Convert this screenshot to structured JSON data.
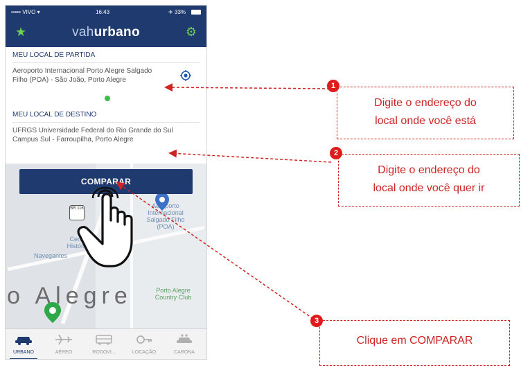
{
  "status_bar": {
    "carrier": "••••• VIVO ▾",
    "time": "16:43",
    "battery": "✈ 33%"
  },
  "app": {
    "logo_light": "vah",
    "logo_bold": "urbano",
    "star_icon": "star-icon",
    "settings_icon": "gear-icon"
  },
  "origin": {
    "label": "MEU LOCAL DE PARTIDA",
    "value": "Aeroporto Internacional Porto Alegre Salgado Filho (POA) - São João, Porto Alegre"
  },
  "destination": {
    "label": "MEU LOCAL DE DESTINO",
    "value": "UFRGS Universidade Federal do Rio Grande do Sul Campus Sul - Farroupilha, Porto Alegre"
  },
  "compare_button": "COMPARAR",
  "map": {
    "highway": "BR 116",
    "airport_label": "Aeroporto Internacional Salgado Filho (POA)",
    "centro_label": "Centro Histórico",
    "navegantes_label": "Navegantes",
    "city_label": "o Alegre",
    "country_club_label": "Porto Alegre Country Club"
  },
  "tabs": [
    {
      "label": "URBANO",
      "active": true
    },
    {
      "label": "AÉREO"
    },
    {
      "label": "RODOVI..."
    },
    {
      "label": "LOCAÇÃO"
    },
    {
      "label": "CARONA"
    }
  ],
  "callouts": [
    {
      "number": "1",
      "line1": "Digite o endereço do",
      "line2": "local onde você está"
    },
    {
      "number": "2",
      "line1": "Digite o endereço do",
      "line2": "local onde você quer ir"
    },
    {
      "number": "3",
      "line1": "Clique em COMPARAR"
    }
  ],
  "colors": {
    "brand": "#1e3a6f",
    "accent": "#6fd04a",
    "callout": "#cf2424"
  }
}
